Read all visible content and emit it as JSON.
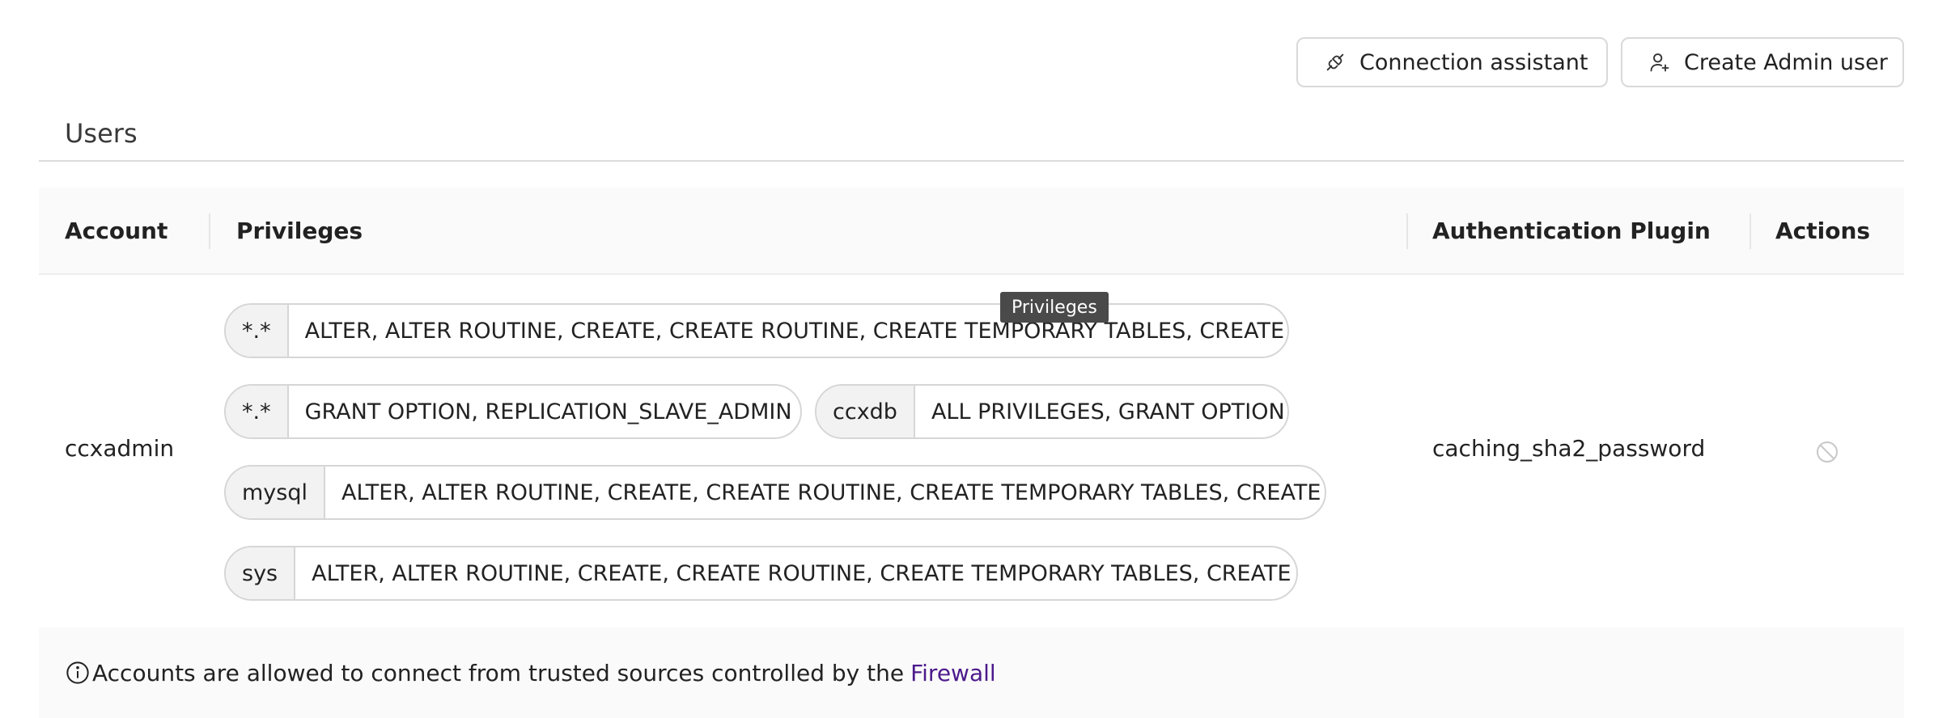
{
  "toolbar": {
    "connection_assistant_label": "Connection assistant",
    "create_admin_label": "Create Admin user"
  },
  "section": {
    "title": "Users"
  },
  "table": {
    "columns": {
      "account": "Account",
      "privileges": "Privileges",
      "auth_plugin": "Authentication Plugin",
      "actions": "Actions"
    },
    "rows": [
      {
        "account": "ccxadmin",
        "auth_plugin": "caching_sha2_password",
        "privileges": [
          {
            "scope": "*.*",
            "list": "ALTER, ALTER ROUTINE, CREATE, CREATE ROUTINE, CREATE TEMPORARY TABLES, CREATE ..."
          },
          {
            "scope": "*.*",
            "list": "GRANT OPTION, REPLICATION_SLAVE_ADMIN"
          },
          {
            "scope": "ccxdb",
            "list": "ALL PRIVILEGES, GRANT OPTION"
          },
          {
            "scope": "mysql",
            "list": "ALTER, ALTER ROUTINE, CREATE, CREATE ROUTINE, CREATE TEMPORARY TABLES, CREATE ..."
          },
          {
            "scope": "sys",
            "list": "ALTER, ALTER ROUTINE, CREATE, CREATE ROUTINE, CREATE TEMPORARY TABLES, CREATE ..."
          }
        ],
        "action_icon": "disabled-icon"
      }
    ]
  },
  "tooltip": {
    "text": "Privileges"
  },
  "footer": {
    "note": "Accounts are allowed to connect from trusted sources controlled by the",
    "link": "Firewall"
  },
  "colors": {
    "link": "#4b1a8c",
    "tooltip_bg": "#4a4a4a",
    "header_bg": "#fafafa"
  }
}
